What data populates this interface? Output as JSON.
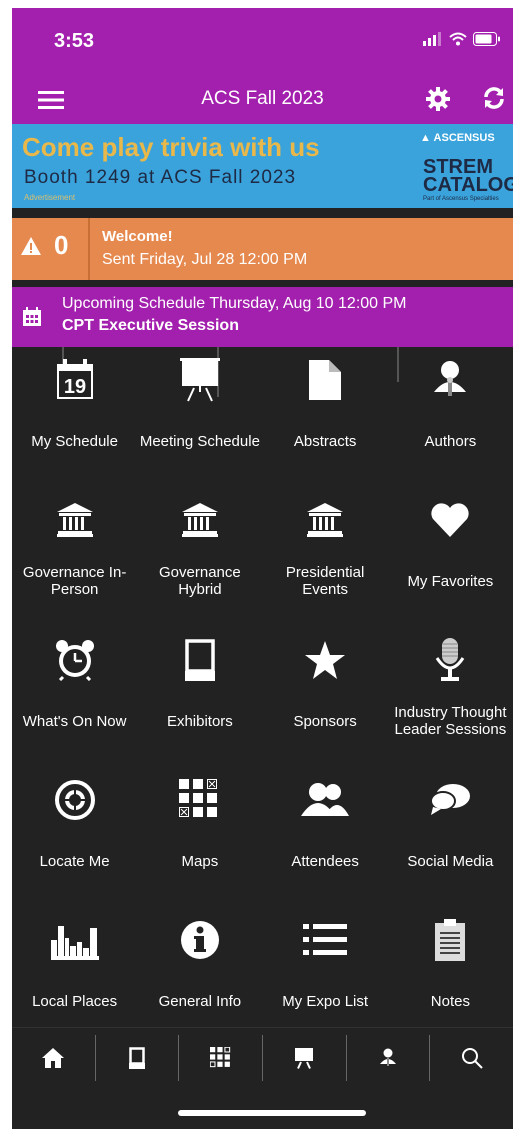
{
  "status_bar": {
    "time": "3:53"
  },
  "nav": {
    "title": "ACS Fall 2023"
  },
  "ad": {
    "headline": "Come play trivia with us",
    "subline": "Booth 1249 at ACS Fall 2023",
    "label": "Advertisement",
    "brand": "ASCENSUS",
    "product_line1": "STREM",
    "product_line2": "CATALOG",
    "product_note": "Part of Ascensus Specialties"
  },
  "alert": {
    "count": "0",
    "title": "Welcome!",
    "subtitle": "Sent Friday, Jul 28 12:00 PM"
  },
  "upcoming": {
    "line1": "Upcoming Schedule Thursday, Aug 10 12:00 PM",
    "line2": "CPT Executive Session"
  },
  "calendar_icon_day": "19",
  "grid": [
    {
      "label": "My Schedule",
      "icon": "calendar-icon"
    },
    {
      "label": "Meeting Schedule",
      "icon": "presentation-icon"
    },
    {
      "label": "Abstracts",
      "icon": "document-icon"
    },
    {
      "label": "Authors",
      "icon": "speaker-icon"
    },
    {
      "label": "Governance In-Person",
      "icon": "building-icon"
    },
    {
      "label": "Governance Hybrid",
      "icon": "building-icon"
    },
    {
      "label": "Presidential Events",
      "icon": "building-icon"
    },
    {
      "label": "My Favorites",
      "icon": "heart-icon"
    },
    {
      "label": "What's On Now",
      "icon": "alarm-clock-icon"
    },
    {
      "label": "Exhibitors",
      "icon": "booth-icon"
    },
    {
      "label": "Sponsors",
      "icon": "star-icon"
    },
    {
      "label": "Industry Thought Leader Sessions",
      "icon": "microphone-icon"
    },
    {
      "label": "Locate Me",
      "icon": "target-icon"
    },
    {
      "label": "Maps",
      "icon": "map-grid-icon"
    },
    {
      "label": "Attendees",
      "icon": "people-icon"
    },
    {
      "label": "Social Media",
      "icon": "chat-bubble-icon"
    },
    {
      "label": "Local Places",
      "icon": "city-skyline-icon"
    },
    {
      "label": "General Info",
      "icon": "info-icon"
    },
    {
      "label": "My Expo List",
      "icon": "list-icon"
    },
    {
      "label": "Notes",
      "icon": "clipboard-icon"
    }
  ],
  "tabbar": [
    "home-icon",
    "booth-icon",
    "map-grid-icon",
    "presentation-icon",
    "speaker-icon",
    "search-icon"
  ],
  "colors": {
    "brand": "#a31fae",
    "alert": "#e5894f",
    "background": "#222222",
    "ad_bg": "#3aa3dc",
    "ad_gold": "#e8b84a"
  }
}
